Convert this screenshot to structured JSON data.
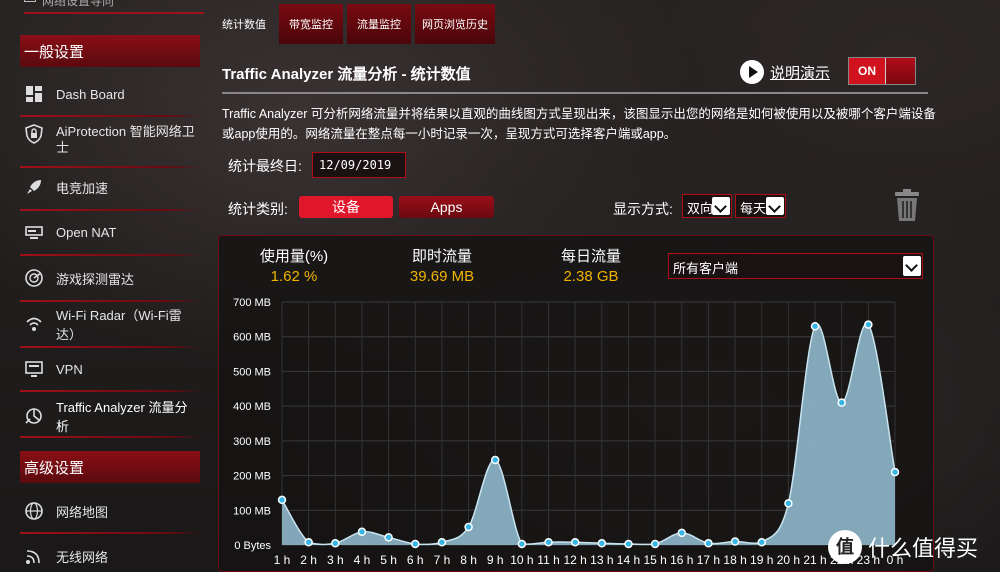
{
  "sidebar": {
    "top_item": "网络设置导向",
    "section_general": "一般设置",
    "section_advanced": "高级设置",
    "items": [
      {
        "label": "Dash Board",
        "icon": "dashboard-icon"
      },
      {
        "label": "AiProtection 智能网络卫士",
        "icon": "shield-lock-icon"
      },
      {
        "label": "电竞加速",
        "icon": "rocket-icon"
      },
      {
        "label": "Open NAT",
        "icon": "nat-icon"
      },
      {
        "label": "游戏探测雷达",
        "icon": "radar-icon"
      },
      {
        "label": "Wi-Fi Radar（Wi-Fi雷达）",
        "icon": "wifi-radar-icon"
      },
      {
        "label": "VPN",
        "icon": "vpn-icon"
      },
      {
        "label": "Traffic Analyzer 流量分析",
        "icon": "traffic-analyzer-icon"
      }
    ],
    "advanced_items": [
      {
        "label": "网络地图",
        "icon": "globe-icon"
      },
      {
        "label": "无线网络",
        "icon": "wireless-icon"
      }
    ]
  },
  "tabs": [
    "统计数值",
    "带宽监控",
    "流量监控",
    "网页浏览历史"
  ],
  "header": {
    "title": "Traffic Analyzer 流量分析 - 统计数值",
    "demo_label": "说明演示",
    "toggle_label": "ON"
  },
  "description": "Traffic Analyzer 可分析网络流量并将结果以直观的曲线图方式呈现出来，该图显示出您的网络是如何被使用以及被哪个客户端设备或app使用的。网络流量在整点每一小时记录一次，呈现方式可选择客户端或app。",
  "filters": {
    "end_date_label": "统计最终日:",
    "end_date_value": "12/09/2019",
    "category_label": "统计类别:",
    "category_device": "设备",
    "category_apps": "Apps",
    "display_label": "显示方式:",
    "direction_value": "双向",
    "period_value": "每天"
  },
  "stats": {
    "usage_label": "使用量(%)",
    "usage_value": "1.62 %",
    "realtime_label": "即时流量",
    "realtime_value": "39.69 MB",
    "daily_label": "每日流量",
    "daily_value": "2.38 GB",
    "client_select": "所有客户端"
  },
  "watermark": {
    "logo": "值",
    "text": "什么值得买"
  },
  "colors": {
    "accent": "#e0162b",
    "value": "#f0b400",
    "area": "#8fb8cc",
    "point": "#37b6e6"
  },
  "chart_data": {
    "type": "area",
    "x": [
      "1 h",
      "2 h",
      "3 h",
      "4 h",
      "5 h",
      "6 h",
      "7 h",
      "8 h",
      "9 h",
      "10 h",
      "11 h",
      "12 h",
      "13 h",
      "14 h",
      "15 h",
      "16 h",
      "17 h",
      "18 h",
      "19 h",
      "20 h",
      "21 h",
      "22 h",
      "23 h",
      "0 h"
    ],
    "values": [
      130,
      8,
      5,
      38,
      22,
      3,
      8,
      52,
      245,
      3,
      8,
      8,
      5,
      3,
      3,
      35,
      5,
      10,
      8,
      120,
      630,
      410,
      635,
      210
    ],
    "ylabel": "",
    "ytick_labels": [
      "0 Bytes",
      "100 MB",
      "200 MB",
      "300 MB",
      "400 MB",
      "500 MB",
      "600 MB",
      "700 MB"
    ],
    "ylim": [
      0,
      700
    ],
    "grid": true
  }
}
